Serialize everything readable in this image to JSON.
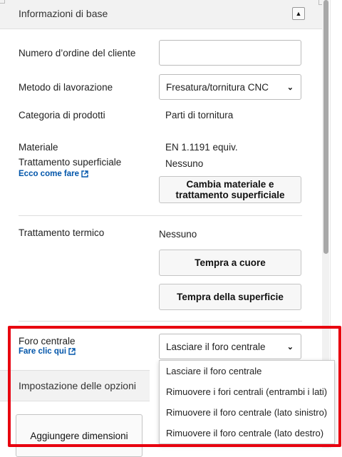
{
  "section": {
    "title": "Informazioni di base",
    "collapse_icon": "triangle-up-icon"
  },
  "fields": {
    "order_number": {
      "label": "Numero d’ordine del cliente",
      "value": ""
    },
    "machining": {
      "label": "Metodo di lavorazione",
      "selected": "Fresatura/tornitura CNC"
    },
    "category": {
      "label": "Categoria di prodotti",
      "value": "Parti di tornitura"
    },
    "material": {
      "label": "Materiale",
      "value": "EN 1.1191 equiv."
    },
    "surface": {
      "label": "Trattamento superficiale",
      "value": "Nessuno",
      "link": "Ecco come fare"
    },
    "change_button": "Cambia materiale e trattamento superficiale",
    "heat": {
      "label": "Trattamento termico",
      "value": "Nessuno"
    },
    "through_harden_button": "Tempra a cuore",
    "surface_harden_button": "Tempra della superficie",
    "center_hole": {
      "label": "Foro centrale",
      "link": "Fare clic qui",
      "selected": "Lasciare il foro centrale",
      "options": [
        "Lasciare il foro centrale",
        "Rimuovere i fori centrali (entrambi i lati)",
        "Rimuovere il foro centrale (lato sinistro)",
        "Rimuovere il foro centrale (lato destro)"
      ]
    }
  },
  "options_section": {
    "title": "Impostazione delle opzioni"
  },
  "add_dimensions_button": "Aggiungere dimensioni",
  "colors": {
    "highlight": "#e8000f",
    "link": "#0055aa"
  }
}
